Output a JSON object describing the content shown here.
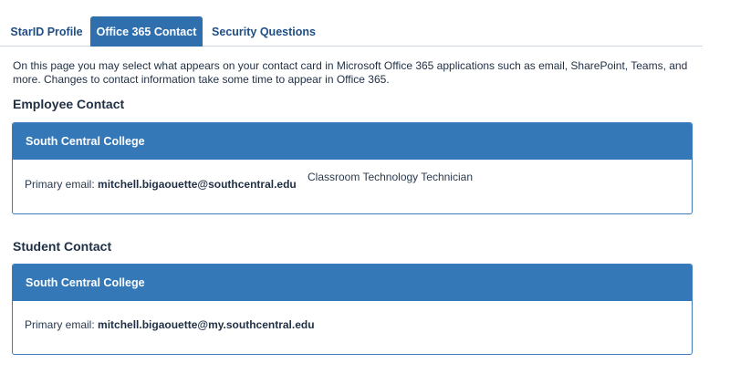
{
  "tabs": [
    {
      "label": "StarID Profile",
      "active": false
    },
    {
      "label": "Office 365 Contact",
      "active": true
    },
    {
      "label": "Security Questions",
      "active": false
    }
  ],
  "intro_text": "On this page you may select what appears on your contact card in Microsoft Office 365 applications such as email, SharePoint, Teams, and more. Changes to contact information take some time to appear in Office 365.",
  "employee": {
    "section_title": "Employee Contact",
    "college": "South Central College",
    "email_label": "Primary email:",
    "email": "mitchell.bigaouette@southcentral.edu",
    "job_title": "Classroom Technology Technician"
  },
  "student": {
    "section_title": "Student Contact",
    "college": "South Central College",
    "email_label": "Primary email:",
    "email": "mitchell.bigaouette@my.southcentral.edu"
  },
  "colors": {
    "accent": "#2f6fae",
    "card_header": "#3478b8",
    "text": "#1f2f44"
  }
}
